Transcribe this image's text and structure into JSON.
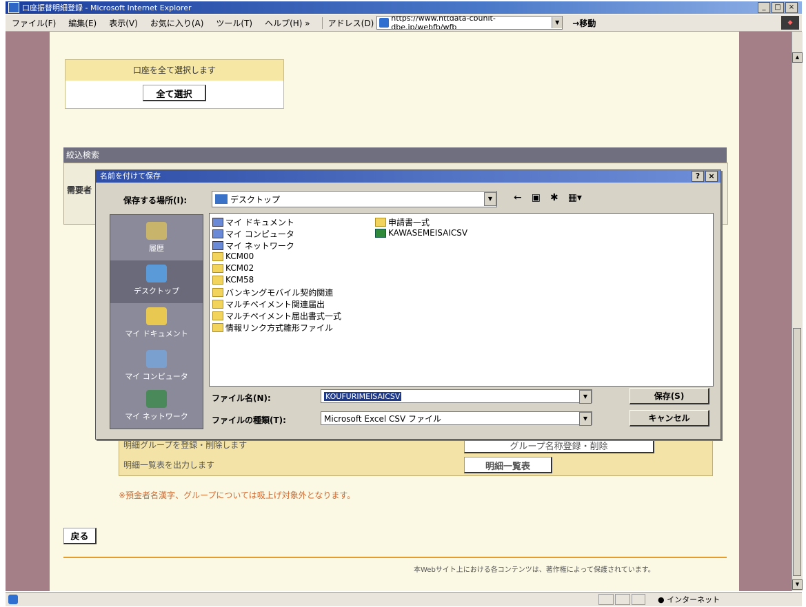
{
  "window": {
    "title": "口座振替明細登録 - Microsoft Internet Explorer",
    "min": "_",
    "max": "□",
    "close": "×"
  },
  "menu": [
    "ファイル(F)",
    "編集(E)",
    "表示(V)",
    "お気に入り(A)",
    "ツール(T)",
    "ヘルプ(H) »"
  ],
  "address": {
    "label": "アドレス(D)",
    "url": "https://www.nttdata-cbunit-dbe.jp/webfb/wfb",
    "go": "移動"
  },
  "page": {
    "select_all_caption": "口座を全て選択します",
    "select_all_button": "全て選択",
    "filter_heading": "絞込検索",
    "filter_label": "需要者",
    "group_text": "明細グループを登録・削除します",
    "group_button": "グループ名称登録・削除",
    "list_text": "明細一覧表を出力します",
    "list_button": "明細一覧表",
    "note": "※預金者名漢字、グループについては吸上げ対象外となります。",
    "back_button": "戻る",
    "copyright": "本Webサイト上における各コンテンツは、著作権によって保護されています。"
  },
  "dialog": {
    "title": "名前を付けて保存",
    "help": "?",
    "close": "×",
    "save_in_label": "保存する場所(I):",
    "save_in_value": "デスクトップ",
    "toolbar_icons": [
      "back-icon",
      "up-folder-icon",
      "new-folder-icon",
      "view-menu-icon"
    ],
    "places": [
      "履歴",
      "デスクトップ",
      "マイ ドキュメント",
      "マイ コンピュータ",
      "マイ ネットワーク"
    ],
    "files_col1": [
      {
        "name": "マイ ドキュメント",
        "type": "sys"
      },
      {
        "name": "マイ コンピュータ",
        "type": "sys"
      },
      {
        "name": "マイ ネットワーク",
        "type": "sys"
      },
      {
        "name": "KCM00",
        "type": "folder"
      },
      {
        "name": "KCM02",
        "type": "folder"
      },
      {
        "name": "KCM58",
        "type": "folder"
      },
      {
        "name": "バンキングモバイル契約関連",
        "type": "folder"
      },
      {
        "name": "マルチペイメント関連届出",
        "type": "folder"
      },
      {
        "name": "マルチペイメント届出書式一式",
        "type": "folder"
      },
      {
        "name": "情報リンク方式雛形ファイル",
        "type": "folder"
      }
    ],
    "files_col2": [
      {
        "name": "申請書一式",
        "type": "folder"
      },
      {
        "name": "KAWASEMEISAICSV",
        "type": "xls"
      }
    ],
    "filename_label": "ファイル名(N):",
    "filename_value": "KOUFURIMEISAICSV",
    "filetype_label": "ファイルの種類(T):",
    "filetype_value": "Microsoft Excel CSV ファイル",
    "save_button": "保存(S)",
    "cancel_button": "キャンセル"
  },
  "status": {
    "zone": "インターネット"
  }
}
